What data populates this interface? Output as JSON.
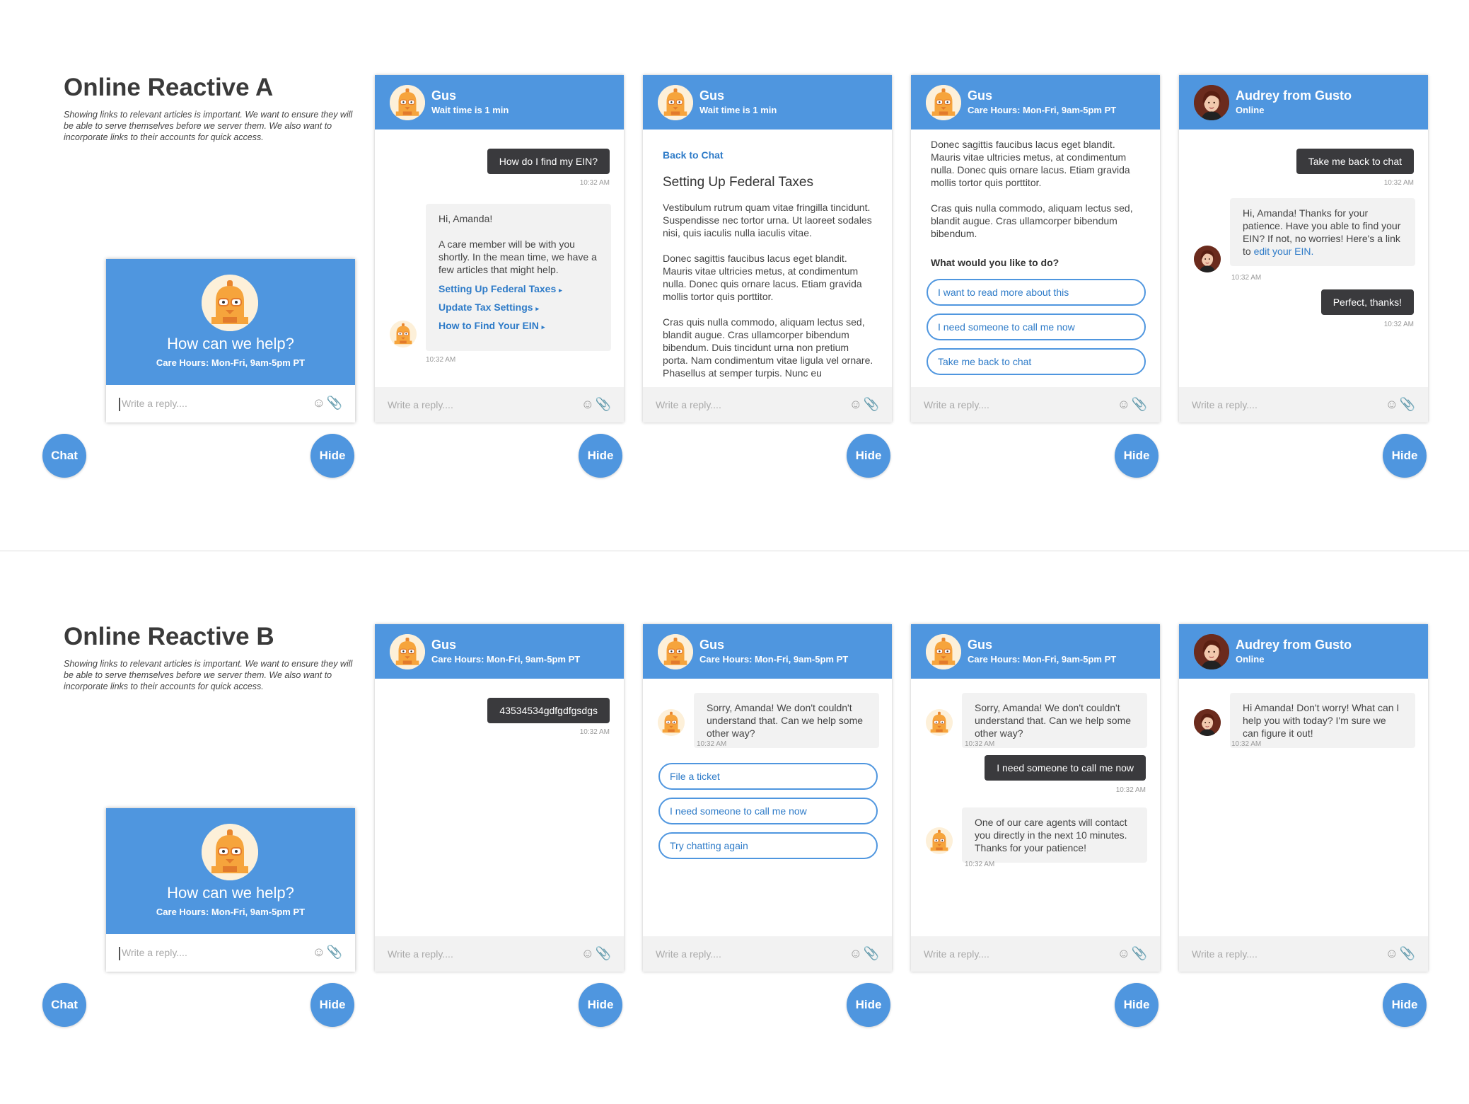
{
  "sections": [
    {
      "title": "Online Reactive A",
      "description": "Showing links to relevant articles is important. We want to ensure they will be able to serve themselves before we server them. We also want to incorporate links to their accounts for quick access."
    },
    {
      "title": "Online Reactive B",
      "description": "Showing links to relevant articles is important. We want to ensure they will be able to serve themselves before we server them. We also want to incorporate links to their accounts for quick access."
    }
  ],
  "launcher": {
    "heading": "How can we help?",
    "hours": "Care Hours: Mon-Fri, 9am-5pm PT",
    "placeholder": "Write a reply....",
    "chat_button": "Chat",
    "hide_button": "Hide"
  },
  "common": {
    "placeholder": "Write a reply....",
    "hide": "Hide",
    "time": "10:32 AM",
    "emoji_icon": "☺",
    "clip_icon": "⌕"
  },
  "a": {
    "p1": {
      "name": "Gus",
      "sub": "Wait time is 1 min",
      "out": "How do I find my EIN?",
      "in_greet": "Hi, Amanda!",
      "in_body": "A care member will be with you shortly. In the mean time, we have a few articles that might help.",
      "links": [
        "Setting Up Federal Taxes",
        "Update Tax Settings",
        "How to Find Your EIN"
      ]
    },
    "p2": {
      "name": "Gus",
      "sub": "Wait time is 1 min",
      "back": "Back to Chat",
      "title": "Setting Up Federal Taxes",
      "para1": "Vestibulum rutrum quam vitae fringilla tincidunt. Suspendisse nec tortor urna. Ut laoreet sodales nisi, quis iaculis nulla iaculis vitae.",
      "para2": "Donec sagittis faucibus lacus eget blandit. Mauris vitae ultricies metus, at condimentum nulla. Donec quis ornare lacus. Etiam gravida mollis tortor quis porttitor.",
      "para3": "Cras quis nulla commodo, aliquam lectus sed, blandit augue. Cras ullamcorper bibendum bibendum. Duis tincidunt urna non pretium porta. Nam condimentum vitae ligula vel ornare. Phasellus at semper turpis. Nunc eu"
    },
    "p3": {
      "name": "Gus",
      "sub": "Care Hours: Mon-Fri, 9am-5pm PT",
      "para1": "Donec sagittis faucibus lacus eget blandit. Mauris vitae ultricies metus, at condimentum nulla. Donec quis ornare lacus. Etiam gravida mollis tortor quis porttitor.",
      "para2": "Cras quis nulla commodo, aliquam lectus sed, blandit augue. Cras ullamcorper bibendum bibendum.",
      "question": "What would you like to do?",
      "choices": [
        "I want to read more about this",
        "I need someone to call me now",
        "Take me back to chat"
      ]
    },
    "p4": {
      "name": "Audrey from Gusto",
      "sub": "Online",
      "out1": "Take me back to chat",
      "in_text": "Hi, Amanda! Thanks for your patience. Have you able to find your EIN? If not, no worries! Here's a link to ",
      "in_link": "edit your EIN.",
      "out2": "Perfect, thanks!"
    }
  },
  "b": {
    "p1": {
      "name": "Gus",
      "sub": "Care Hours: Mon-Fri, 9am-5pm PT",
      "out": "43534534gdfgdfgsdgs"
    },
    "p2": {
      "name": "Gus",
      "sub": "Care Hours: Mon-Fri, 9am-5pm PT",
      "in": "Sorry, Amanda! We don't couldn't understand that. Can we help some other way?",
      "choices": [
        "File a ticket",
        "I need someone to call me now",
        "Try chatting again"
      ]
    },
    "p3": {
      "name": "Gus",
      "sub": "Care Hours: Mon-Fri, 9am-5pm PT",
      "in1": "Sorry, Amanda! We don't couldn't understand that. Can we help some other way?",
      "out": "I need someone to call me now",
      "in2": "One of our care agents will contact you directly in the next 10 minutes. Thanks for your patience!"
    },
    "p4": {
      "name": "Audrey from Gusto",
      "sub": "Online",
      "in": "Hi Amanda! Don't worry! What can I help you with today? I'm sure we can figure it out!"
    }
  }
}
